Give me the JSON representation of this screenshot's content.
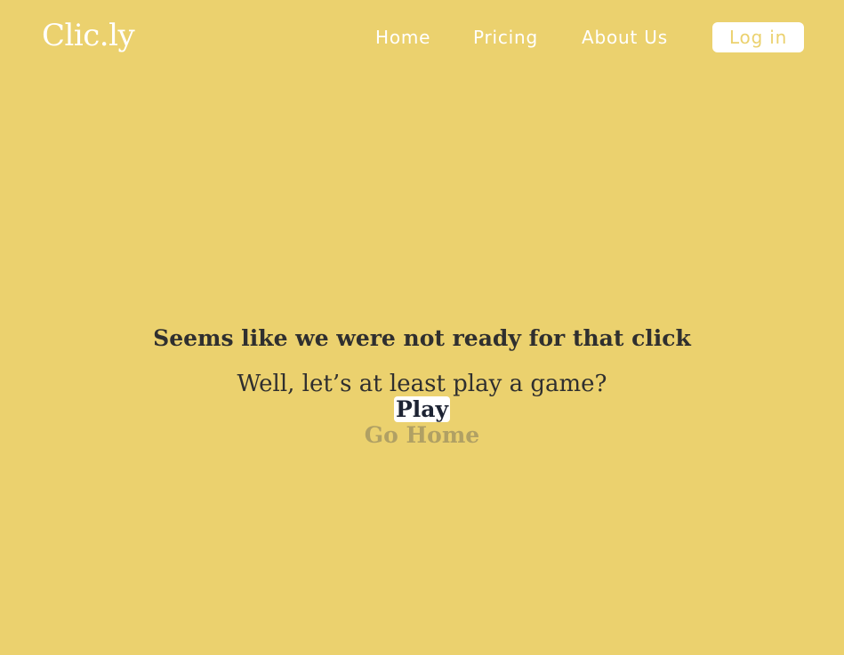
{
  "brand": {
    "logo": "Clic.ly"
  },
  "nav": {
    "home": "Home",
    "pricing": "Pricing",
    "about": "About Us",
    "login": "Log in"
  },
  "main": {
    "headline": "Seems like we were not ready for that click",
    "subline": "Well, let’s at least play a game?",
    "play_label": "Play",
    "home_label": "Go Home"
  },
  "colors": {
    "background": "#ebd16e",
    "text": "#2f2f2f",
    "play_text": "#1d2333",
    "muted_link": "#b0a064",
    "white": "#ffffff"
  }
}
